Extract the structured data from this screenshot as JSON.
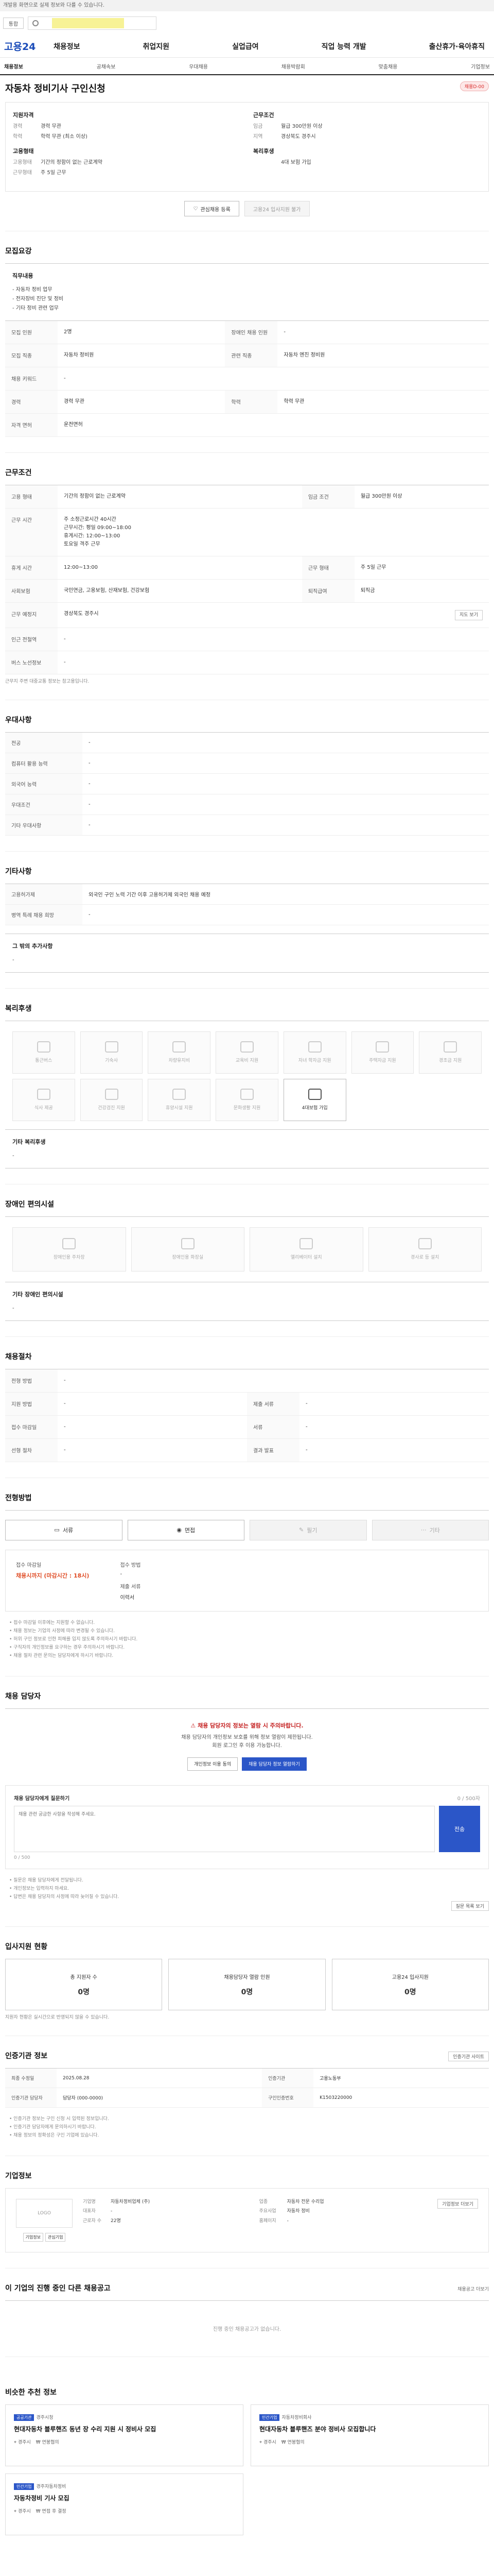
{
  "top_notice": "개발용 화면으로 실제 정보와 다를 수 있습니다.",
  "search": {
    "scope": "통합",
    "placeholder": ""
  },
  "logo": "고용24",
  "gnb": [
    "채용정보",
    "취업지원",
    "실업급여",
    "직업 능력 개발",
    "출산휴가·육아휴직"
  ],
  "sub_nav": [
    "채용정보",
    "공채속보",
    "우대채용",
    "채용박람회",
    "맞춤채용",
    "기업정보"
  ],
  "job": {
    "title": "자동차 정비기사 구인신청",
    "status_badge": "채용D-00",
    "summary": {
      "qual_title": "지원자격",
      "qual": [
        [
          "경력",
          "경력 무관"
        ],
        [
          "학력",
          "학력 무관 (최소 이상)"
        ]
      ],
      "cond_title": "근무조건",
      "cond": [
        [
          "임금",
          "월급 300만원 이상"
        ],
        [
          "지역",
          "경상북도 경주시"
        ]
      ],
      "emp_title": "고용형태",
      "emp": [
        [
          "고용형태",
          "기간의 정함이 없는 근로계약"
        ],
        [
          "근무형태",
          "주 5일 근무"
        ]
      ],
      "welfare_title": "복리후생",
      "welfare": [
        [
          "",
          "4대 보험 가입"
        ]
      ]
    },
    "btn_interest": "관심채용 등록",
    "btn_apply": "고용24 입사지원 불가"
  },
  "recruit": {
    "title": "모집요강",
    "duty_label": "직무내용",
    "duties": [
      "자동차 정비 업무",
      "전자장비 진단 및 정비",
      "기타 정비 관련 업무"
    ],
    "rows": [
      [
        "모집 인원",
        "2명",
        "장애인 채용 인원",
        "-"
      ],
      [
        "모집 직종",
        "자동차 정비원",
        "관련 직종",
        "자동차 엔진 정비원"
      ],
      [
        "채용 키워드",
        "-",
        "",
        ""
      ],
      [
        "경력",
        "경력 무관",
        "학력",
        "학력 무관"
      ],
      [
        "자격 면허",
        "운전면허",
        "",
        ""
      ]
    ]
  },
  "work": {
    "title": "근무조건",
    "emp_type": "기간의 정함이 없는 근로계약",
    "wage_label": "월급 300만원 이상",
    "hours": [
      "주 소정근로시간 40시간",
      "근무시간: 평일 09:00~18:00",
      "휴게시간: 12:00~13:00",
      "토요일 격주 근무"
    ],
    "rows": [
      [
        "고용 형태",
        "기간의 정함이 없는 근로계약",
        "임금 조건",
        "월급 300만원 이상"
      ],
      [
        "근무 시간",
        "주 소정근로시간 40시간",
        "",
        ""
      ],
      [
        "휴게 시간",
        "12:00~13:00",
        "근무 형태",
        "주 5일 근무"
      ],
      [
        "사회보험",
        "국민연금, 고용보험, 산재보험, 건강보험",
        "퇴직급여",
        "퇴직금"
      ],
      [
        "근무 예정지",
        "경상북도 경주시",
        "",
        ""
      ],
      [
        "인근 전철역",
        "-",
        "",
        ""
      ],
      [
        "버스 노선정보",
        "-",
        "",
        ""
      ]
    ],
    "map_btn": "지도 보기",
    "note": "근무지 주변 대중교통 정보는 참고용입니다."
  },
  "prefer": {
    "title": "우대사항",
    "rows": [
      [
        "전공",
        "-"
      ],
      [
        "컴퓨터 활용 능력",
        "-"
      ],
      [
        "외국어 능력",
        "-"
      ],
      [
        "우대조건",
        "-"
      ],
      [
        "기타 우대사항",
        "-"
      ]
    ]
  },
  "etc": {
    "title": "기타사항",
    "rows": [
      [
        "고용허가제",
        "외국인 구인 노력 기간 이후 고용허가제 외국인 채용 예정"
      ],
      [
        "병역 특례 채용 희망",
        "-"
      ]
    ],
    "extra_label": "그 밖의 추가사항",
    "extra": "-"
  },
  "welfare": {
    "title": "복리후생",
    "items": [
      {
        "name": "통근버스",
        "on": false
      },
      {
        "name": "기숙사",
        "on": false
      },
      {
        "name": "차량유지비",
        "on": false
      },
      {
        "name": "교육비 지원",
        "on": false
      },
      {
        "name": "자녀 학자금 지원",
        "on": false
      },
      {
        "name": "주택자금 지원",
        "on": false
      },
      {
        "name": "경조금 지원",
        "on": false
      },
      {
        "name": "식사 제공",
        "on": false
      },
      {
        "name": "건강검진 지원",
        "on": false
      },
      {
        "name": "휴양시설 지원",
        "on": false
      },
      {
        "name": "문화생활 지원",
        "on": false
      },
      {
        "name": "4대보험 가입",
        "on": true
      }
    ],
    "extra_label": "기타 복리후생",
    "extra": "-"
  },
  "disabled": {
    "title": "장애인 편의시설",
    "items": [
      "장애인용 주차장",
      "장애인용 화장실",
      "엘리베이터 설치",
      "경사로 등 설치"
    ],
    "extra_label": "기타 장애인 편의시설",
    "extra": "-"
  },
  "process": {
    "title": "채용절차",
    "rows": [
      [
        "전형 방법",
        "-",
        "",
        ""
      ],
      [
        "지원 방법",
        "-",
        "제출 서류",
        "-"
      ],
      [
        "접수 마감일",
        "-",
        "서류",
        "-"
      ],
      [
        "선형 절차",
        "-",
        "결과 발표",
        "-"
      ]
    ]
  },
  "method": {
    "title": "전형방법",
    "items": [
      {
        "name": "서류",
        "on": true
      },
      {
        "name": "면접",
        "on": true
      },
      {
        "name": "필기",
        "on": false
      },
      {
        "name": "기타",
        "on": false
      }
    ]
  },
  "apply": {
    "period_label": "접수 마감일",
    "period_value": "채용시까지 (마감시간 : 18시)",
    "method_label": "접수 방법",
    "method_value": "-",
    "docs_label": "제출 서류",
    "docs_value": "이력서",
    "bullets": [
      "접수 마감일 이후에는 지원할 수 없습니다.",
      "채용 정보는 기업의 사정에 따라 변경될 수 있습니다.",
      "허위 구인 정보로 인한 피해를 입지 않도록 주의하시기 바랍니다.",
      "구직자의 개인정보를 요구하는 경우 주의하시기 바랍니다.",
      "채용 절차 관련 문의는 담당자에게 하시기 바랍니다."
    ]
  },
  "manager": {
    "title": "채용 담당자",
    "warn": "채용 담당자의 정보는 열람 시 주의바랍니다.",
    "desc1": "채용 담당자의 개인정보 보호를 위해 정보 열람이 제한됩니다.",
    "desc2": "회원 로그인 후 이용 가능합니다.",
    "btn1": "개인정보 이용 동의",
    "btn2": "채용 담당자 정보 열람하기",
    "qa_title": "채용 담당자에게 질문하기",
    "qa_right": "0 / 500자",
    "qa_placeholder": "채용 관련 궁금한 사항을 작성해 주세요.",
    "qa_btn": "전송",
    "qa_count": "0 / 500",
    "notes": [
      "질문은 채용 담당자에게 전달됩니다.",
      "개인정보는 입력하지 마세요.",
      "답변은 채용 담당자의 사정에 따라 늦어질 수 있습니다."
    ],
    "qa_more": "질문 목록 보기"
  },
  "applicants": {
    "title": "입사지원 현황",
    "items": [
      {
        "label": "총 지원자 수",
        "value": "0명"
      },
      {
        "label": "채용담당자 열람 인원",
        "value": "0명"
      },
      {
        "label": "고용24 입사지원",
        "value": "0명"
      }
    ],
    "note": "지원자 현황은 실시간으로 반영되지 않을 수 있습니다."
  },
  "info": {
    "title": "인증기관 정보",
    "btn": "인증기관 사이트",
    "rows": [
      [
        "최종 수정일",
        "2025.08.28",
        "인증기관",
        "고용노동부"
      ],
      [
        "인증기관 담당자",
        "담당자 (000-0000)",
        "구인인증번호",
        "K1503220000"
      ]
    ],
    "notes": [
      "인증기관 정보는 구인 신청 시 입력된 정보입니다.",
      "인증기관 담당자에게 문의하시기 바랍니다.",
      "채용 정보의 정확성은 구인 기업에 있습니다."
    ]
  },
  "corp": {
    "title": "기업정보",
    "logo_text": "LOGO",
    "logo_btns": [
      "기업정보",
      "관심기업"
    ],
    "fields": [
      [
        "기업명",
        "자동차정비업체 (주)"
      ],
      [
        "업종",
        "자동차 전문 수리업"
      ],
      [
        "대표자",
        "-"
      ],
      [
        "주요사업",
        "자동차 정비"
      ],
      [
        "근로자 수",
        "22명"
      ],
      [
        "홈페이지",
        "-"
      ]
    ],
    "corp_btn": "기업정보 더보기"
  },
  "other_jobs": {
    "title": "이 기업의 진행 중인 다른 채용공고",
    "right": "채용공고 더보기",
    "empty": "진행 중인 채용공고가 없습니다."
  },
  "recommend": {
    "title": "비슷한 추천 정보",
    "cards": [
      {
        "tag": "공공기관",
        "co": "경주시청",
        "title": "현대자동차 블루핸즈 동년 장 수리 지원 시 정비사 모집",
        "loc": "경주시",
        "pay": "연봉협의"
      },
      {
        "tag": "민간기업",
        "co": "자동차정비회사",
        "title": "현대자동차 블루핸즈 분야 정비사 모집합니다",
        "loc": "경주시",
        "pay": "연봉협의"
      },
      {
        "tag": "민간기업",
        "co": "경주자동차정비",
        "title": "자동차정비 기사 모집",
        "loc": "경주시",
        "pay": "면접 후 결정"
      }
    ]
  }
}
